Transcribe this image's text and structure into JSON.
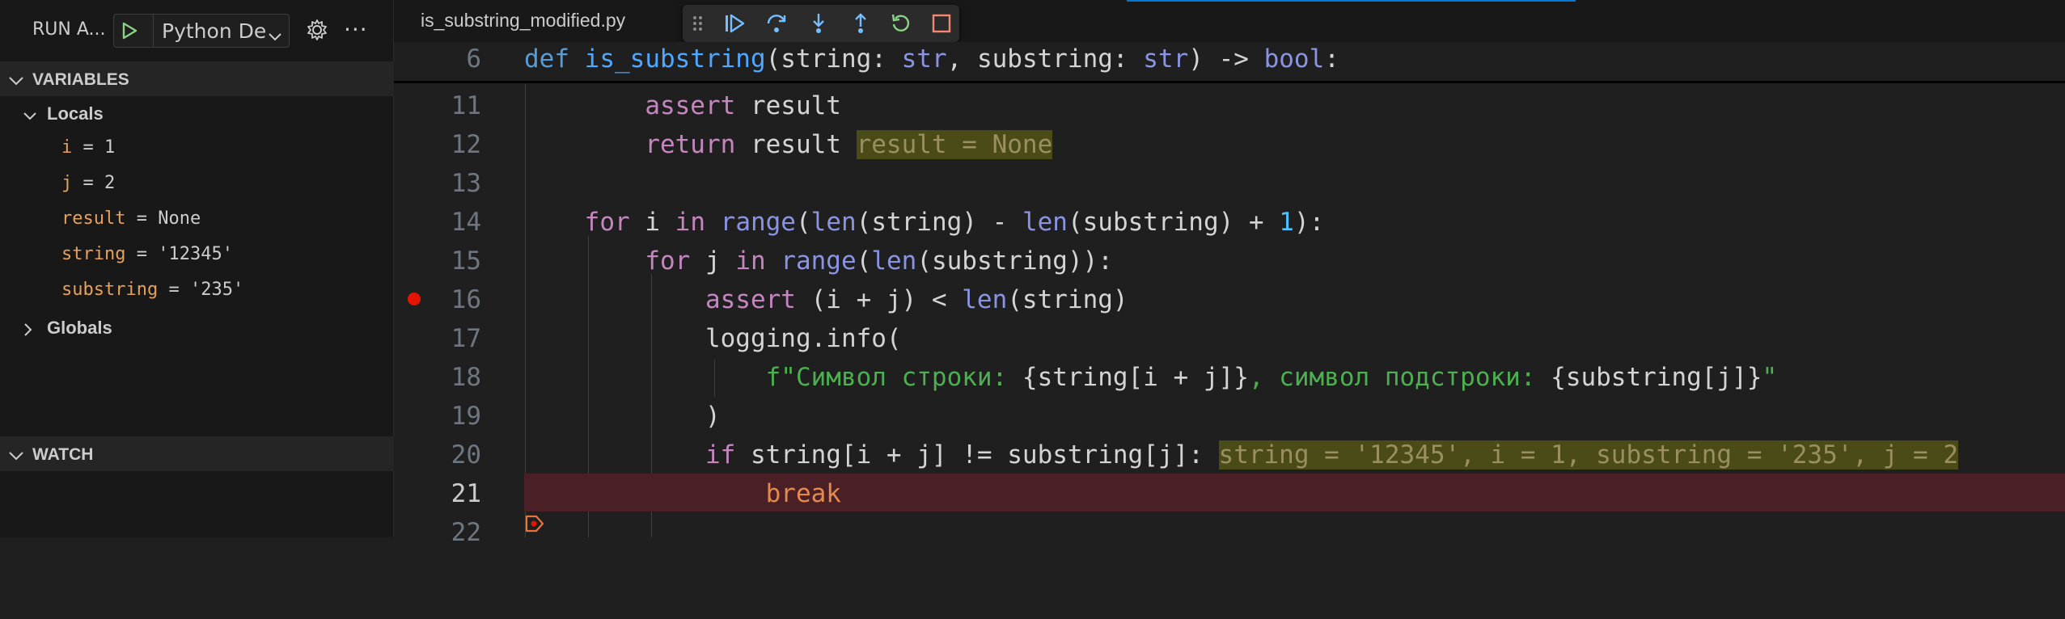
{
  "run": {
    "label": "RUN A...",
    "config": "Python De",
    "more": "···"
  },
  "variables": {
    "header": "VARIABLES",
    "locals_label": "Locals",
    "globals_label": "Globals",
    "locals": [
      {
        "name": "i",
        "value": "1"
      },
      {
        "name": "j",
        "value": "2"
      },
      {
        "name": "result",
        "value": "None"
      },
      {
        "name": "string",
        "value": "'12345'"
      },
      {
        "name": "substring",
        "value": "'235'"
      }
    ]
  },
  "watch": {
    "header": "WATCH"
  },
  "editor": {
    "tab": "is_substring_modified.py",
    "sticky": {
      "line": "6",
      "def": "def",
      "fname": "is_substring",
      "p1": "(string: ",
      "t1": "str",
      "p2": ", substring: ",
      "t2": "str",
      "p3": ") -> ",
      "t3": "bool",
      "p4": ":"
    },
    "lines": {
      "l11": {
        "n": "11",
        "kw": "assert",
        "rest": " result"
      },
      "l12": {
        "n": "12",
        "kw": "return",
        "rest": " result ",
        "inline": "result = None"
      },
      "l13": {
        "n": "13"
      },
      "l14": {
        "n": "14",
        "for": "for",
        "a": " i ",
        "in": "in",
        "b": " ",
        "range": "range",
        "c": "(",
        "len1": "len",
        "d": "(string) - ",
        "len2": "len",
        "e": "(substring) + ",
        "one": "1",
        "f": "):"
      },
      "l15": {
        "n": "15",
        "for": "for",
        "a": " j ",
        "in": "in",
        "b": " ",
        "range": "range",
        "c": "(",
        "len1": "len",
        "d": "(substring)):"
      },
      "l16": {
        "n": "16",
        "kw": "assert",
        "a": " (i + j) < ",
        "len": "len",
        "b": "(string)"
      },
      "l17": {
        "n": "17",
        "text": "logging.info("
      },
      "l18": {
        "n": "18",
        "s1": "f\"Символ строки: ",
        "i1": "{string[i + j]}",
        "s2": ", символ подстроки: ",
        "i2": "{substring[j]}",
        "s3": "\""
      },
      "l19": {
        "n": "19",
        "text": ")"
      },
      "l20": {
        "n": "20",
        "kw": "if",
        "a": " string[i + j] != substring[j]: ",
        "inline": "string = '12345', i = 1, substring = '235', j = 2"
      },
      "l21": {
        "n": "21",
        "kw": "break"
      },
      "l22": {
        "n": "22"
      }
    }
  },
  "colors": {
    "breakpoint": "#e51400",
    "current_line": "#4b1f26",
    "accent": "#0078d4"
  }
}
